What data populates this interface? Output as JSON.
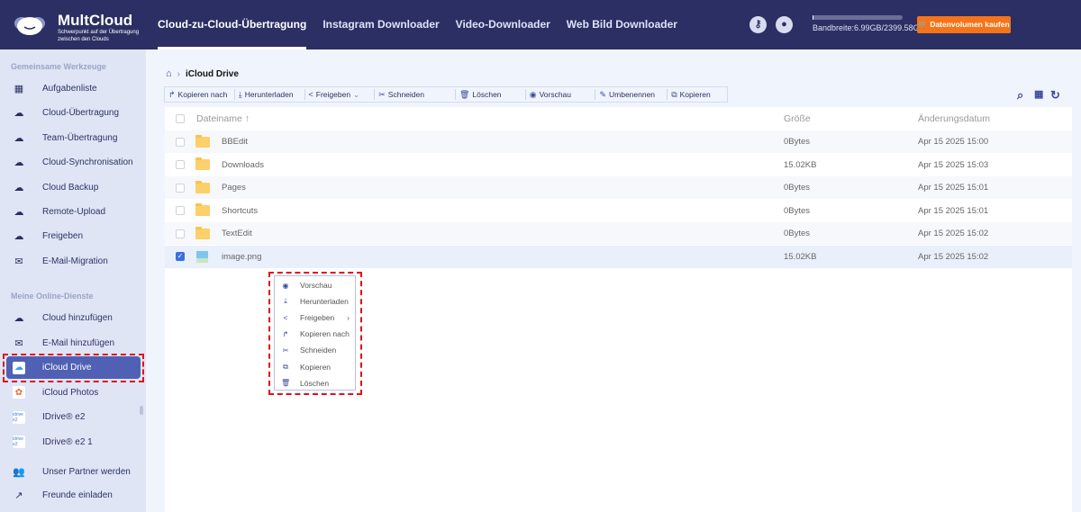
{
  "header": {
    "logo_title": "MultCloud",
    "logo_subtitle_1": "Schwerpunkt auf der Übertragung",
    "logo_subtitle_2": "zwischen den Clouds",
    "nav": [
      "Cloud-zu-Cloud-Übertragung",
      "Instagram Downloader",
      "Video-Downloader",
      "Web Bild Downloader"
    ],
    "active_nav": 0,
    "bandwidth_label": "Bandbreite:6.99GB/2399.58GB",
    "bandwidth_used_fraction": 0.003,
    "buy_label": "Datenvolumen kaufen",
    "colors": {
      "header_bg": "#2b2f63",
      "buy_button": "#f5741a"
    }
  },
  "sidebar": {
    "section1": "Gemeinsame Werkzeuge",
    "tools": [
      {
        "label": "Aufgabenliste",
        "icon": "grid-icon"
      },
      {
        "label": "Cloud-Übertragung",
        "icon": "cloud-transfer-icon"
      },
      {
        "label": "Team-Übertragung",
        "icon": "team-transfer-icon"
      },
      {
        "label": "Cloud-Synchronisation",
        "icon": "cloud-sync-icon"
      },
      {
        "label": "Cloud Backup",
        "icon": "cloud-backup-icon"
      },
      {
        "label": "Remote-Upload",
        "icon": "remote-upload-icon"
      },
      {
        "label": "Freigeben",
        "icon": "cloud-share-icon"
      },
      {
        "label": "E-Mail-Migration",
        "icon": "email-migration-icon"
      }
    ],
    "section2": "Meine Online-Dienste",
    "services": [
      {
        "label": "Cloud hinzufügen",
        "icon": "add-cloud-icon"
      },
      {
        "label": "E-Mail hinzufügen",
        "icon": "add-email-icon"
      },
      {
        "label": "iCloud Drive",
        "icon": "icloud-drive-icon",
        "selected": true
      },
      {
        "label": "iCloud Photos",
        "icon": "icloud-photos-icon"
      },
      {
        "label": "IDrive® e2",
        "icon": "idrive-icon",
        "app_text": "idrive e2"
      },
      {
        "label": "IDrive® e2 1",
        "icon": "idrive-icon",
        "app_text": "idrive e2"
      }
    ],
    "extra": [
      {
        "label": "Unser Partner werden",
        "icon": "partner-icon"
      },
      {
        "label": "Freunde einladen",
        "icon": "invite-icon"
      }
    ]
  },
  "breadcrumb": {
    "current": "iCloud Drive"
  },
  "toolbar": [
    "Kopieren nach",
    "Herunterladen",
    "Freigeben",
    "Schneiden",
    "Löschen",
    "Vorschau",
    "Umbenennen",
    "Kopieren"
  ],
  "table": {
    "headers": {
      "name": "Dateiname",
      "size": "Größe",
      "date": "Änderungsdatum"
    },
    "rows": [
      {
        "name": "BBEdit",
        "type": "folder",
        "size": "0Bytes",
        "date": "Apr 15 2025 15:00",
        "checked": false
      },
      {
        "name": "Downloads",
        "type": "folder",
        "size": "15.02KB",
        "date": "Apr 15 2025 15:03",
        "checked": false
      },
      {
        "name": "Pages",
        "type": "folder",
        "size": "0Bytes",
        "date": "Apr 15 2025 15:01",
        "checked": false
      },
      {
        "name": "Shortcuts",
        "type": "folder",
        "size": "0Bytes",
        "date": "Apr 15 2025 15:01",
        "checked": false
      },
      {
        "name": "TextEdit",
        "type": "folder",
        "size": "0Bytes",
        "date": "Apr 15 2025 15:02",
        "checked": false
      },
      {
        "name": "image.png",
        "type": "image",
        "size": "15.02KB",
        "date": "Apr 15 2025 15:02",
        "checked": true
      }
    ]
  },
  "context_menu": [
    "Vorschau",
    "Herunterladen",
    "Freigeben",
    "Kopieren nach",
    "Schneiden",
    "Kopieren",
    "Löschen"
  ]
}
